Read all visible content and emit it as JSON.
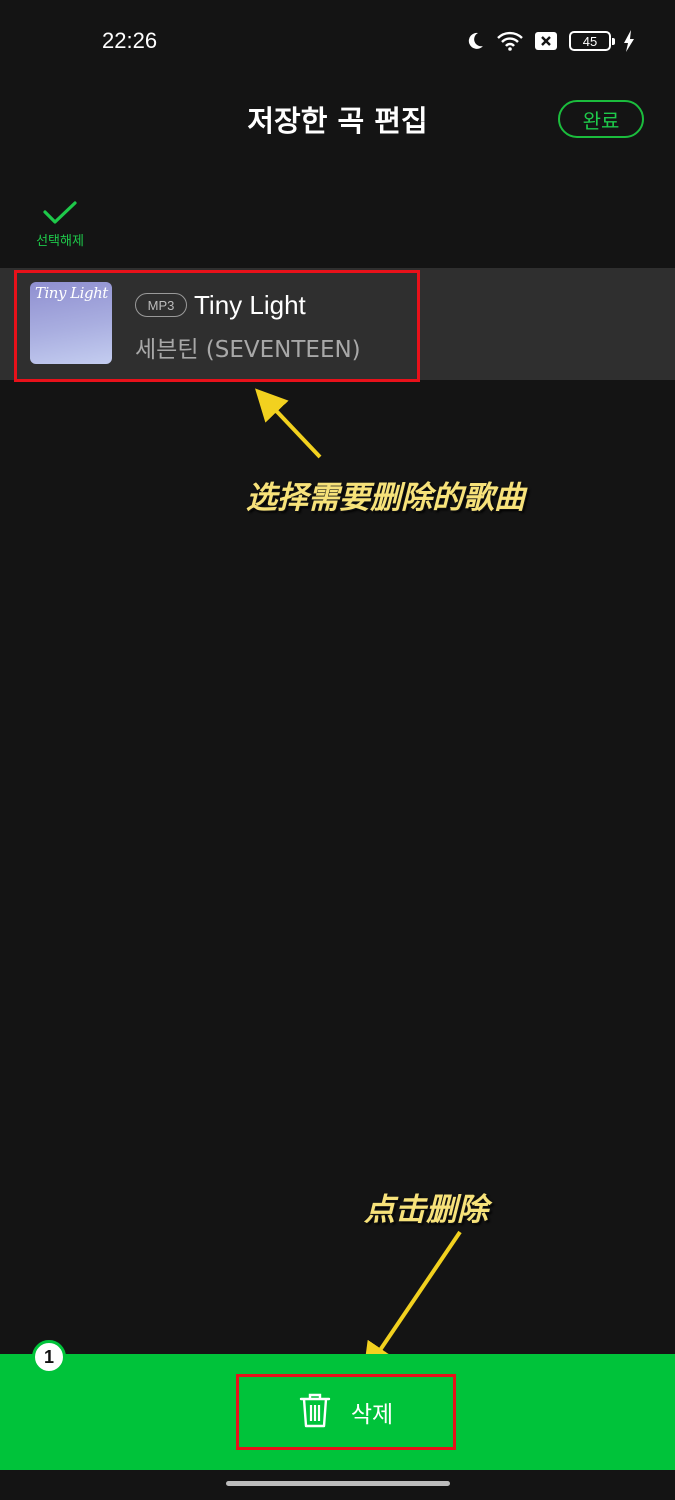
{
  "status_bar": {
    "time": "22:26",
    "battery": "45",
    "icons": [
      "moon-icon",
      "wifi-icon",
      "notification-x-icon",
      "battery-icon",
      "charging-icon"
    ]
  },
  "header": {
    "title": "저장한 곡 편집",
    "done_label": "완료"
  },
  "selection": {
    "deselect_label": "선택해제"
  },
  "songs": [
    {
      "album_art_text": "Tiny Light",
      "badge": "MP3",
      "title": "Tiny Light",
      "artist": "세븐틴 (SEVENTEEN)",
      "selected": true
    }
  ],
  "annotations": {
    "select_hint": "选择需要删除的歌曲",
    "delete_hint": "点击删除"
  },
  "bottom_bar": {
    "selected_count": "1",
    "delete_label": "삭제"
  },
  "colors": {
    "background": "#141414",
    "accent_green": "#00c33a",
    "highlight_red": "#e8111a",
    "annotation_yellow": "#f7e27a"
  }
}
